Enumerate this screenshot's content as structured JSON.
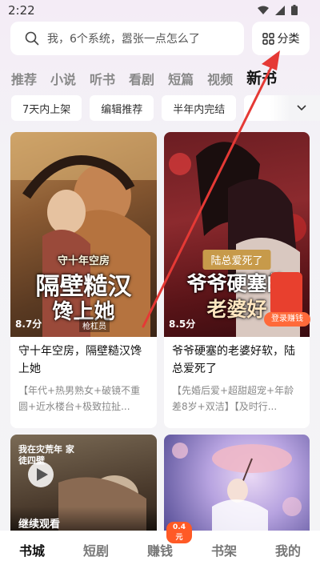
{
  "status_bar": {
    "time": "2:22"
  },
  "search": {
    "placeholder": "我，6个系统，嚣张一点怎么了"
  },
  "category_button": {
    "label": "分类"
  },
  "tabs": [
    {
      "label": "推荐",
      "active": false
    },
    {
      "label": "小说",
      "active": false
    },
    {
      "label": "听书",
      "active": false
    },
    {
      "label": "看剧",
      "active": false
    },
    {
      "label": "短篇",
      "active": false
    },
    {
      "label": "视频",
      "active": false
    },
    {
      "label": "新书",
      "active": true
    }
  ],
  "filters": [
    "7天内上架",
    "编辑推荐",
    "半年内完结"
  ],
  "books": [
    {
      "cover_title_line1": "守十年空房",
      "cover_title_line2": "隔壁糙汉",
      "cover_title_line3": "馋上她",
      "cover_author": "枪杠员",
      "rating": "8.7分",
      "title": "守十年空房，隔壁糙汉馋上她",
      "tags": "【年代+热男熟女+破镜不重圆+近水楼台+极致拉扯..."
    },
    {
      "cover_banner": "陆总爱死了",
      "cover_title_line1": "爷爷硬塞的",
      "cover_title_line2": "老婆好",
      "rating": "8.5分",
      "title": "爷爷硬塞的老婆好软，陆总爱死了",
      "tags": "【先婚后爱+超甜超宠+年龄差8岁+双洁】【及时行..."
    },
    {
      "cover_text": "我在灾荒年 家徒四壁",
      "continue_label": "继续观看"
    },
    {
      "cover_text": ""
    }
  ],
  "reward_float": {
    "label": "登录赚钱"
  },
  "bottom_nav": [
    {
      "label": "书城",
      "active": true
    },
    {
      "label": "短剧",
      "active": false
    },
    {
      "label": "赚钱",
      "active": false,
      "badge": "0.4元"
    },
    {
      "label": "书架",
      "active": false
    },
    {
      "label": "我的",
      "active": false
    }
  ],
  "colors": {
    "accent": "#e53935",
    "badge": "#ff5a26"
  }
}
